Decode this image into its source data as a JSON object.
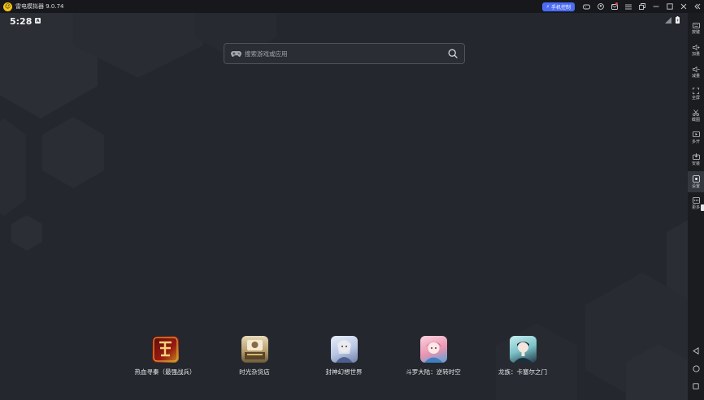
{
  "window": {
    "title": "雷电模拟器 9.0.74",
    "remote_control_label": "手机控制",
    "icons": [
      "gamepad-icon",
      "user-icon",
      "mail-icon",
      "menu-icon",
      "restore-icon",
      "minimize-icon",
      "maximize-icon",
      "close-icon",
      "collapse-icon"
    ]
  },
  "status_bar": {
    "time": "5:28",
    "notification_glyph": "A"
  },
  "search": {
    "placeholder": "搜索游戏或应用"
  },
  "apps": [
    {
      "label": "热血寻秦（最强战兵）",
      "colors": [
        "#7a1010",
        "#c8921d"
      ]
    },
    {
      "label": "时光杂货店",
      "colors": [
        "#d9c9a4",
        "#6b5a3a"
      ]
    },
    {
      "label": "封神幻想世界",
      "colors": [
        "#c7d4ea",
        "#7f8fb8"
      ]
    },
    {
      "label": "斗罗大陆：逆转时空",
      "colors": [
        "#f3b7c9",
        "#5aa0d8"
      ]
    },
    {
      "label": "龙族：卡塞尔之门",
      "colors": [
        "#9fd6d8",
        "#203a48"
      ]
    }
  ],
  "sidebar": {
    "items": [
      {
        "label": "按键",
        "icon": "keyboard-icon"
      },
      {
        "label": "加量",
        "icon": "volume-up-icon"
      },
      {
        "label": "减量",
        "icon": "volume-down-icon"
      },
      {
        "label": "全屏",
        "icon": "fullscreen-icon"
      },
      {
        "label": "截图",
        "icon": "scissors-icon"
      },
      {
        "label": "多开",
        "icon": "multi-instance-icon"
      },
      {
        "label": "安装",
        "icon": "install-icon"
      },
      {
        "label": "设置",
        "icon": "settings-icon"
      },
      {
        "label": "更多",
        "icon": "more-icon"
      }
    ],
    "nav": [
      "back-icon",
      "home-icon",
      "recents-icon"
    ]
  },
  "colors": {
    "accent": "#4a6cf7",
    "background": "#24272d",
    "sidebar": "#1b1c20",
    "titlebar": "#17181b"
  }
}
